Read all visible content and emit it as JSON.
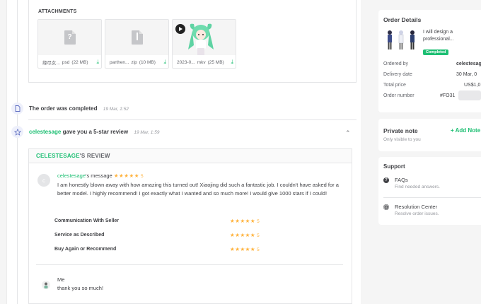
{
  "attachments": {
    "title": "ATTACHMENTS",
    "files": [
      {
        "name": "缘尽女...",
        "ext": "psd",
        "size": "(22 MB)",
        "icon": "document-icon"
      },
      {
        "name": "parthen...",
        "ext": "zip",
        "size": "(10 MB)",
        "icon": "zip-icon"
      },
      {
        "name": "2023-0...",
        "ext": "mkv",
        "size": "(25 MB)",
        "icon": "play-icon"
      }
    ]
  },
  "events": {
    "completed": {
      "text": "The order was completed",
      "time": "19 Mar, 1:52"
    },
    "review": {
      "user": "celestesage",
      "text": " gave you a 5-star review",
      "time": "19 Mar, 1:59"
    }
  },
  "review": {
    "header_user": "CELESTESAGE",
    "header_suffix": "'S REVIEW",
    "avatar_letter": "c",
    "message_user": "celestesage",
    "message_suffix": "'s message",
    "stars": "★★★★★",
    "score": "5",
    "body": "I am honestly blown away with how amazing this turned out! Xiaojing did such a fantastic job. I couldn't have asked for a better model. I highly recommend! I got exactly what I wanted and so much more! I would give 1000 stars if I could!",
    "criteria": [
      {
        "label": "Communication With Seller",
        "stars": "★★★★★",
        "score": "5"
      },
      {
        "label": "Service as Described",
        "stars": "★★★★★",
        "score": "5"
      },
      {
        "label": "Buy Again or Recommend",
        "stars": "★★★★★",
        "score": "5"
      }
    ],
    "reply": {
      "name": "Me",
      "text": "thank you so much!"
    }
  },
  "order_details": {
    "title": "Order Details",
    "gig_title": "I will design a professional...",
    "status": "Completed",
    "rows": [
      {
        "label": "Ordered by",
        "value": "celestesage"
      },
      {
        "label": "Delivery date",
        "value": "30 Mar, 0"
      },
      {
        "label": "Total price",
        "value": "US$1,0"
      },
      {
        "label": "Order number",
        "value": "#FO31"
      }
    ]
  },
  "private_note": {
    "title": "Private note",
    "add": "+ Add Note",
    "subtitle": "Only visible to you"
  },
  "support": {
    "title": "Support",
    "items": [
      {
        "title": "FAQs",
        "subtitle": "Find needed answers.",
        "icon": "question-icon"
      },
      {
        "title": "Resolution Center",
        "subtitle": "Resolve order issues.",
        "icon": "globe-icon"
      }
    ]
  },
  "colors": {
    "accent": "#1dbf73",
    "star": "#ffb33e",
    "text": "#404145",
    "muted": "#95979d"
  }
}
